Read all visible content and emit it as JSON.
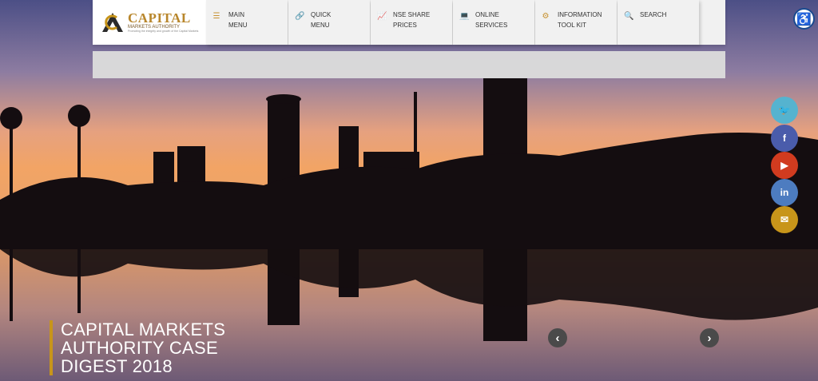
{
  "logo": {
    "title": "CAPITAL",
    "subtitle": "MARKETS AUTHORITY",
    "tagline": "Promoting the integrity and growth of the Capital Markets"
  },
  "nav": [
    {
      "line1": "MAIN",
      "line2": "MENU",
      "icon": "list-icon"
    },
    {
      "line1": "QUICK",
      "line2": "MENU",
      "icon": "link-icon"
    },
    {
      "line1": "NSE SHARE",
      "line2": "PRICES",
      "icon": "chart-icon"
    },
    {
      "line1": "ONLINE",
      "line2": "SERVICES",
      "icon": "laptop-icon"
    },
    {
      "line1": "INFORMATION",
      "line2": "TOOL KIT",
      "icon": "gears-icon"
    },
    {
      "line1": "SEARCH",
      "line2": "",
      "icon": "search-icon"
    }
  ],
  "social": [
    {
      "name": "twitter",
      "icon": "twitter-icon",
      "color": "#55b3cf"
    },
    {
      "name": "facebook",
      "icon": "facebook-icon",
      "color": "#4a5cab"
    },
    {
      "name": "youtube",
      "icon": "youtube-icon",
      "color": "#d13b1f"
    },
    {
      "name": "linkedin",
      "icon": "linkedin-icon",
      "color": "#4d7cc0"
    },
    {
      "name": "email",
      "icon": "envelope-icon",
      "color": "#c8951a"
    }
  ],
  "social_glyphs": {
    "twitter": "🐦",
    "facebook": "f",
    "youtube": "▶",
    "linkedin": "in",
    "email": "✉"
  },
  "caption": {
    "line1": "CAPITAL MARKETS",
    "line2": "AUTHORITY CASE",
    "line3": "DIGEST 2018"
  },
  "carousel": {
    "prev": "‹",
    "next": "›"
  },
  "colors": {
    "accent": "#c8951a",
    "nav_bg": "#f1f1f1"
  }
}
